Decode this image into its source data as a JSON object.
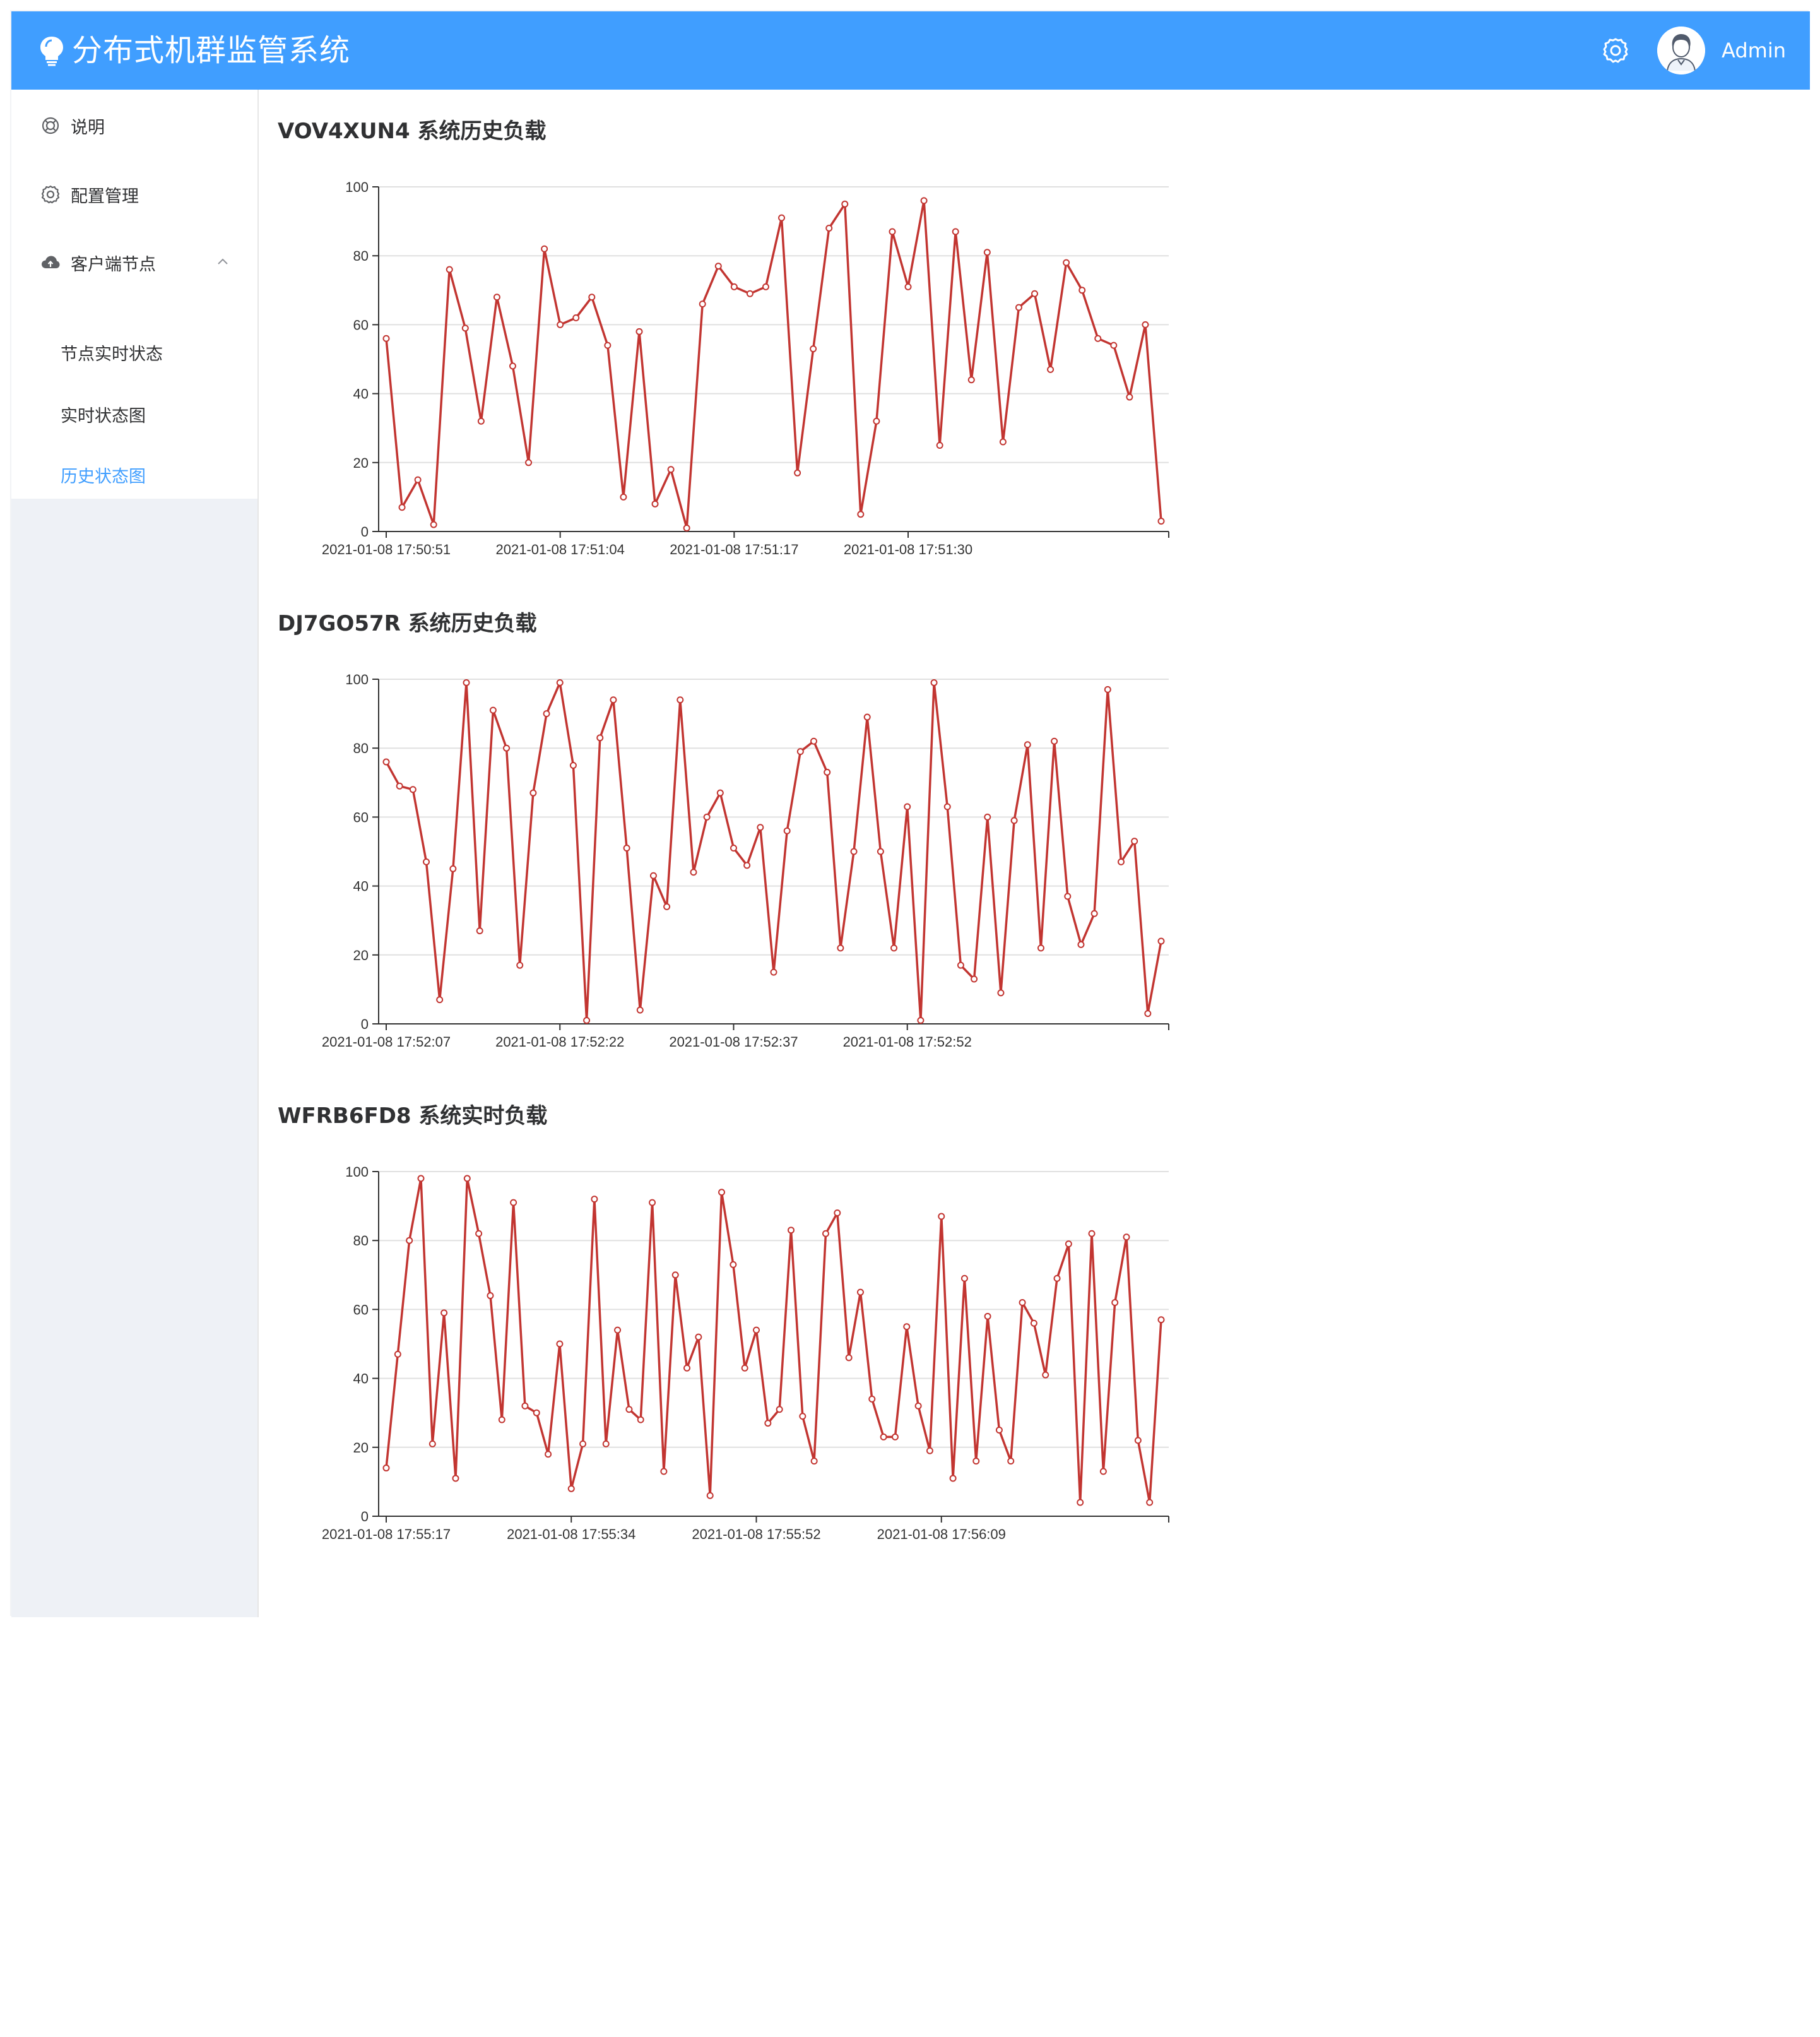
{
  "header": {
    "app_title": "分布式机群监管系统",
    "user_name": "Admin",
    "brand_color": "#409eff",
    "icons": {
      "logo": "lightbulb-icon",
      "settings": "gear-icon",
      "avatar": "user-avatar"
    }
  },
  "sidebar": {
    "items": [
      {
        "label": "说明",
        "icon": "lifebuoy-icon"
      },
      {
        "label": "配置管理",
        "icon": "gear-icon"
      },
      {
        "label": "客户端节点",
        "icon": "cloud-icon",
        "expanded": true
      }
    ],
    "sub_items": [
      {
        "label": "节点实时状态",
        "active": false
      },
      {
        "label": "实时状态图",
        "active": false
      },
      {
        "label": "历史状态图",
        "active": true
      }
    ],
    "active_color": "#409eff"
  },
  "chart_data": [
    {
      "type": "line",
      "title": "VOV4XUN4 系统历史负载",
      "x_tick_labels": [
        "2021-01-08 17:50:51",
        "2021-01-08 17:51:04",
        "2021-01-08 17:51:17",
        "2021-01-08 17:51:30"
      ],
      "y_ticks": [
        0,
        20,
        40,
        60,
        80,
        100
      ],
      "ylim": [
        0,
        100
      ],
      "grid": true,
      "line_color": "#c23531",
      "values": [
        56,
        7,
        15,
        2,
        76,
        59,
        32,
        68,
        48,
        20,
        82,
        60,
        62,
        68,
        54,
        10,
        58,
        8,
        18,
        1,
        66,
        77,
        71,
        69,
        71,
        91,
        17,
        53,
        88,
        95,
        5,
        32,
        87,
        71,
        96,
        25,
        87,
        44,
        81,
        26,
        65,
        69,
        47,
        78,
        70,
        56,
        54,
        39,
        60,
        3
      ]
    },
    {
      "type": "line",
      "title": "DJ7GO57R 系统历史负载",
      "x_tick_labels": [
        "2021-01-08 17:52:07",
        "2021-01-08 17:52:22",
        "2021-01-08 17:52:37",
        "2021-01-08 17:52:52"
      ],
      "y_ticks": [
        0,
        20,
        40,
        60,
        80,
        100
      ],
      "ylim": [
        0,
        100
      ],
      "grid": true,
      "line_color": "#c23531",
      "values": [
        76,
        69,
        68,
        47,
        7,
        45,
        99,
        27,
        91,
        80,
        17,
        67,
        90,
        99,
        75,
        1,
        83,
        94,
        51,
        4,
        43,
        34,
        94,
        44,
        60,
        67,
        51,
        46,
        57,
        15,
        56,
        79,
        82,
        73,
        22,
        50,
        89,
        50,
        22,
        63,
        1,
        99,
        63,
        17,
        13,
        60,
        9,
        59,
        81,
        22,
        82,
        37,
        23,
        32,
        97,
        47,
        53,
        3,
        24
      ]
    },
    {
      "type": "line",
      "title": "WFRB6FD8 系统实时负载",
      "x_tick_labels": [
        "2021-01-08 17:55:17",
        "2021-01-08 17:55:34",
        "2021-01-08 17:55:52",
        "2021-01-08 17:56:09"
      ],
      "y_ticks": [
        0,
        20,
        40,
        60,
        80,
        100
      ],
      "ylim": [
        0,
        100
      ],
      "grid": true,
      "line_color": "#c23531",
      "values": [
        14,
        47,
        80,
        98,
        21,
        59,
        11,
        98,
        82,
        64,
        28,
        91,
        32,
        30,
        18,
        50,
        8,
        21,
        92,
        21,
        54,
        31,
        28,
        91,
        13,
        70,
        43,
        52,
        6,
        94,
        73,
        43,
        54,
        27,
        31,
        83,
        29,
        16,
        82,
        88,
        46,
        65,
        34,
        23,
        23,
        55,
        32,
        19,
        87,
        11,
        69,
        16,
        58,
        25,
        16,
        62,
        56,
        41,
        69,
        79,
        4,
        82,
        13,
        62,
        81,
        22,
        4,
        57
      ]
    }
  ]
}
